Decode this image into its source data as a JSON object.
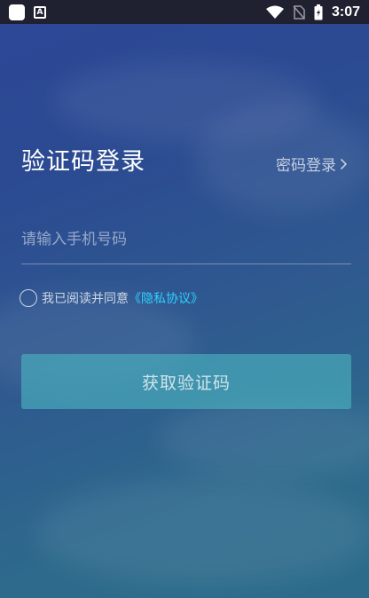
{
  "status_bar": {
    "time": "3:07",
    "notification_letter": "A"
  },
  "login": {
    "title": "验证码登录",
    "switch_link": "密码登录",
    "phone_placeholder": "请输入手机号码",
    "phone_value": "",
    "agreement_text": "我已阅读并同意",
    "policy_link": "《隐私协议》",
    "agreement_checked": false,
    "submit_label": "获取验证码"
  },
  "colors": {
    "status_bar": "#1f2130",
    "background_top": "#2c4797",
    "background_bottom": "#2c6c8a",
    "button": "#4ab0be",
    "link": "#2fd0ff"
  },
  "icons": [
    "app-square-icon",
    "notification-a-icon",
    "wifi-icon",
    "sim-off-icon",
    "battery-icon",
    "chevron-right-icon"
  ]
}
